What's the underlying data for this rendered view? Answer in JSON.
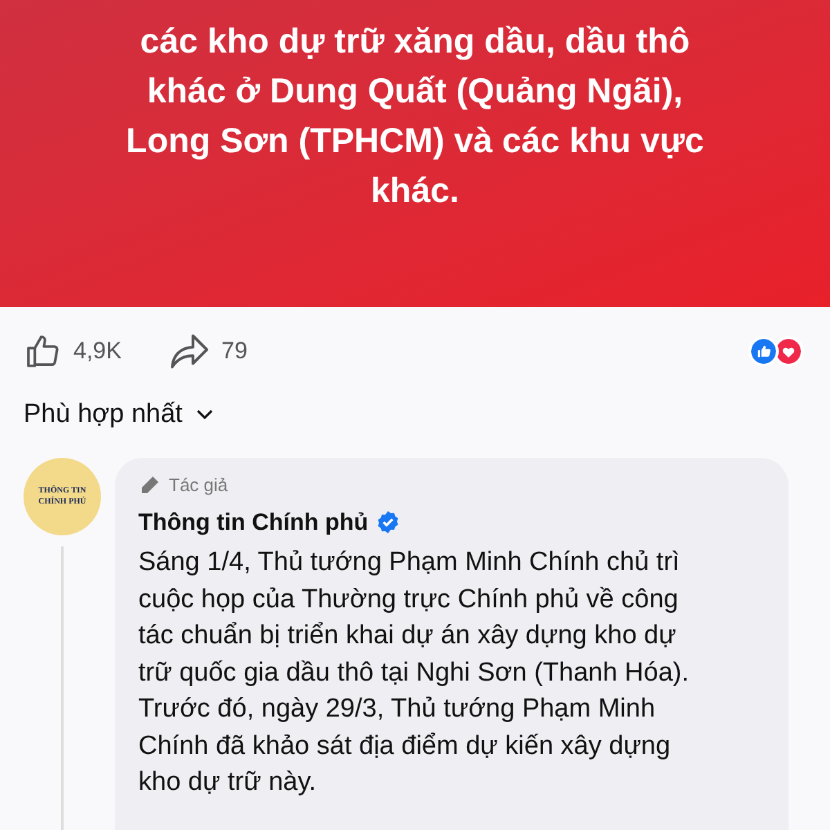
{
  "banner": {
    "lines": [
      "các kho dự trữ xăng dầu, dầu thô",
      "khác ở Dung Quất (Quảng Ngãi),",
      "Long Sơn (TPHCM) và các khu vực",
      "khác."
    ]
  },
  "stats": {
    "likes": "4,9K",
    "shares": "79",
    "reactions": [
      {
        "kind": "like",
        "color": "#1877f2"
      },
      {
        "kind": "love",
        "color": "#f0284a"
      }
    ]
  },
  "sort": {
    "label": "Phù hợp nhất"
  },
  "comment": {
    "avatar_lines": [
      "THÔNG TIN",
      "CHÍNH PHỦ"
    ],
    "badge": "Tác giả",
    "author": "Thông tin Chính phủ",
    "verified": true,
    "lines": [
      "Sáng 1/4, Thủ tướng Phạm Minh Chính chủ trì",
      "cuộc họp của Thường trực Chính phủ về công",
      "tác chuẩn bị triển khai dự án xây dựng kho dự",
      "trữ quốc gia dầu thô tại Nghi Sơn (Thanh Hóa).",
      "Trước đó, ngày 29/3, Thủ tướng Phạm Minh",
      "Chính đã khảo sát địa điểm dự kiến xây dựng",
      "kho dự trữ này."
    ]
  }
}
